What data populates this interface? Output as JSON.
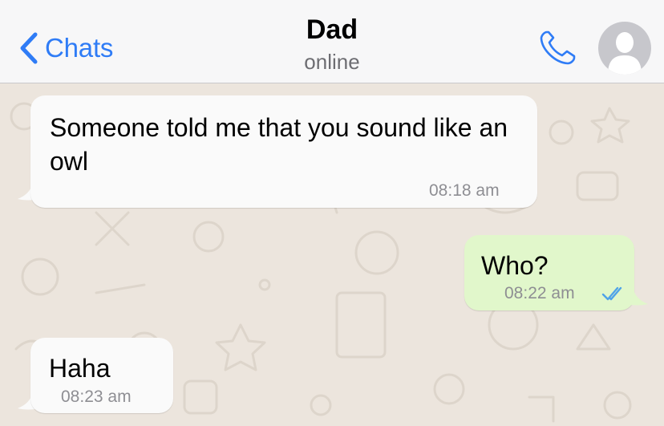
{
  "header": {
    "back_label": "Chats",
    "contact_name": "Dad",
    "status": "online",
    "accent": "#2f7cf6"
  },
  "messages": [
    {
      "direction": "incoming",
      "text": "Someone told me that you sound like an owl",
      "time": "08:18 am"
    },
    {
      "direction": "outgoing",
      "text": "Who?",
      "time": "08:22 am",
      "receipt": "double-check-icon (read)"
    },
    {
      "direction": "incoming",
      "text": "Haha",
      "time": "08:23 am"
    }
  ],
  "colors": {
    "incoming_bubble": "#fafafa",
    "outgoing_bubble": "#e1f7cb",
    "chat_background": "#ece5dd",
    "read_receipt": "#4fa3e8"
  }
}
